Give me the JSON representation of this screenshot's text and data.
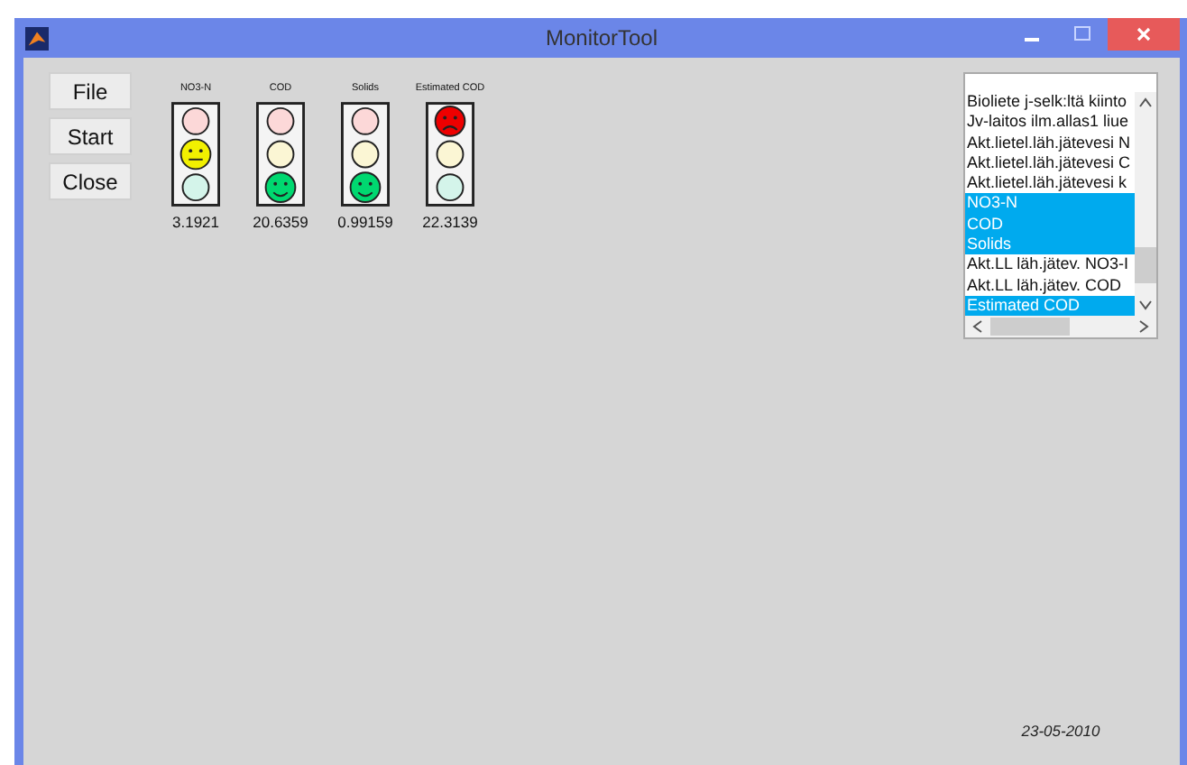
{
  "window": {
    "title": "MonitorTool"
  },
  "buttons": [
    "File",
    "Start",
    "Close"
  ],
  "lights": [
    {
      "label": "NO3-N",
      "red_on": false,
      "yellow_on": true,
      "green_on": false,
      "value": "3.1921"
    },
    {
      "label": "COD",
      "red_on": false,
      "yellow_on": false,
      "green_on": true,
      "value": "20.6359"
    },
    {
      "label": "Solids",
      "red_on": false,
      "yellow_on": false,
      "green_on": true,
      "value": "0.99159"
    },
    {
      "label": "Estimated COD",
      "red_on": true,
      "yellow_on": false,
      "green_on": false,
      "value": "22.3139"
    }
  ],
  "list": {
    "items": [
      {
        "text": "Bioliete j-selk:ltä kiinto",
        "selected": false
      },
      {
        "text": "Jv-laitos ilm.allas1 liue",
        "selected": false
      },
      {
        "text": "Akt.lietel.läh.jätevesi N",
        "selected": false
      },
      {
        "text": "Akt.lietel.läh.jätevesi C",
        "selected": false
      },
      {
        "text": "Akt.lietel.läh.jätevesi k",
        "selected": false
      },
      {
        "text": "NO3-N",
        "selected": true
      },
      {
        "text": "COD",
        "selected": true
      },
      {
        "text": "Solids",
        "selected": true
      },
      {
        "text": "Akt.LL läh.jätev. NO3-I",
        "selected": false
      },
      {
        "text": "Akt.LL läh.jätev. COD",
        "selected": false
      },
      {
        "text": "Estimated COD",
        "selected": true
      }
    ]
  },
  "date": "23-05-2010"
}
